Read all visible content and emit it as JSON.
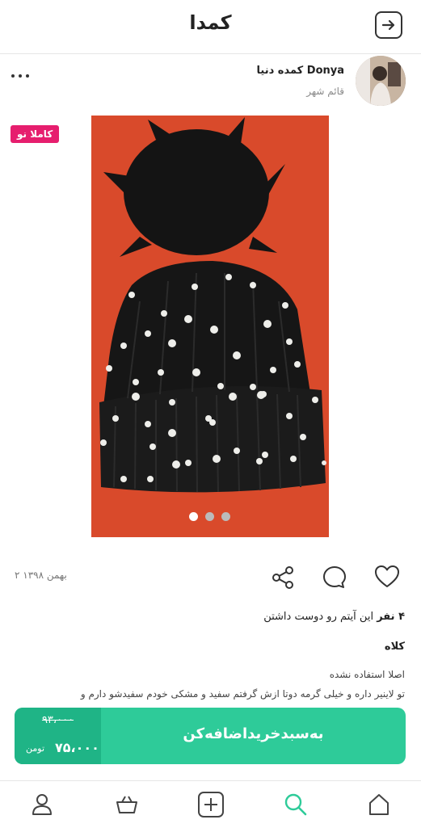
{
  "header": {
    "title": "کمدا",
    "back_icon": "arrow-right-icon"
  },
  "seller": {
    "name": "کمده دنیا Donya",
    "city": "قائم شهر",
    "more_icon": "more-dots-icon"
  },
  "product": {
    "badge": "کاملا نو",
    "image_icon": "product-photo",
    "carousel": {
      "total": 3,
      "active": 1
    },
    "date": "۲ بهمن ۱۳۹۸",
    "likes_count": "۴ نفر",
    "likes_text": " این آیتم رو دوست داشتن",
    "title": "کلاه",
    "description_1": "اصلا استفاده نشده",
    "description_2": "تو لاینیر داره و خیلی گرمه دوتا ازش گرفتم سفید و مشکی خودم سفیدشو دارم و"
  },
  "actions": {
    "like_icon": "heart-icon",
    "comment_icon": "comment-icon",
    "share_icon": "share-icon"
  },
  "buy": {
    "old_price": "۹۳،۰۰۰",
    "new_price": "۷۵،۰۰۰",
    "currency": "تومن",
    "add_to_cart": "به‌سبد‌خرید‌اضافه‌کن"
  },
  "nav": {
    "items": [
      "home-icon",
      "search-icon",
      "add-icon",
      "basket-icon",
      "profile-icon"
    ]
  },
  "colors": {
    "accent": "#2ecb99",
    "accent_dark": "#1fb486",
    "badge": "#e61e6e",
    "active_nav": "#2ecb99"
  }
}
